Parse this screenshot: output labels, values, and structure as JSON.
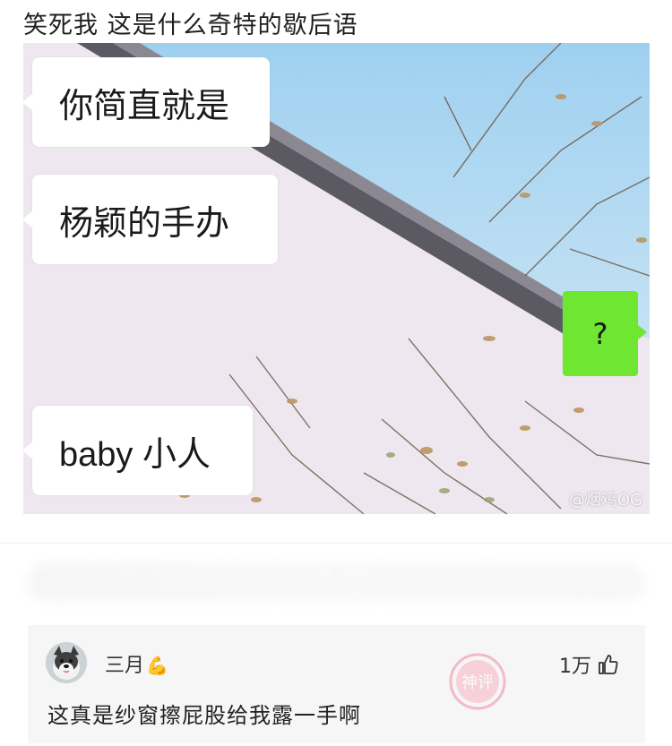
{
  "post": {
    "title": "笑死我 这是什么奇特的歇后语",
    "bubbles": {
      "first": "你简直就是",
      "second": "杨颖的手办",
      "third": "baby 小人",
      "reply": "?"
    },
    "watermark": "@烟鸡OG"
  },
  "comment": {
    "username": "三月",
    "user_emoji": "💪",
    "likes": "1万",
    "text": "这真是纱窗擦屁股给我露一手啊",
    "stamp_text": "神评"
  },
  "colors": {
    "green_bubble": "#6ee632",
    "sky": "#a9d3f0",
    "wall": "#efe7ef",
    "stamp": "#f08aa4"
  }
}
